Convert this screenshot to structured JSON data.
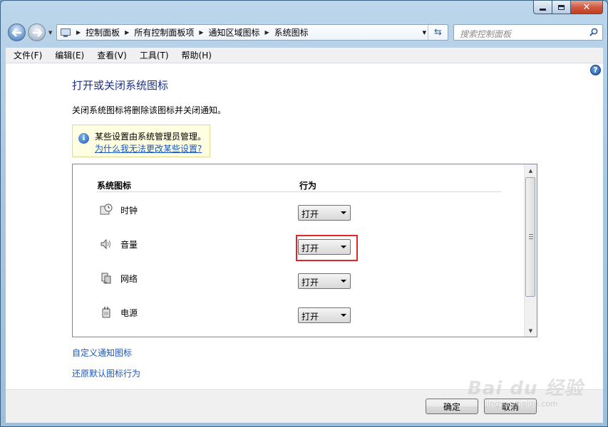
{
  "address": {
    "crumbs": [
      "控制面板",
      "所有控制面板项",
      "通知区域图标",
      "系统图标"
    ]
  },
  "search": {
    "placeholder": "搜索控制面板"
  },
  "menu": [
    "文件(F)",
    "编辑(E)",
    "查看(V)",
    "工具(T)",
    "帮助(H)"
  ],
  "page": {
    "title": "打开或关闭系统图标",
    "description": "关闭系统图标将删除该图标并关闭通知。",
    "info_text": "某些设置由系统管理员管理。",
    "info_link": "为什么我无法更改某些设置?"
  },
  "table": {
    "col_icon": "系统图标",
    "col_behavior": "行为",
    "rows": [
      {
        "name": "时钟",
        "value": "打开",
        "icon": "clock-icon"
      },
      {
        "name": "音量",
        "value": "打开",
        "icon": "speaker-icon"
      },
      {
        "name": "网络",
        "value": "打开",
        "icon": "network-icon"
      },
      {
        "name": "电源",
        "value": "打开",
        "icon": "power-icon"
      }
    ]
  },
  "links": {
    "customize": "自定义通知图标",
    "restore": "还原默认图标行为"
  },
  "buttons": {
    "ok": "确定",
    "cancel": "取消"
  },
  "watermark": {
    "main": "Bai du 经验",
    "sub": "jingyan.baidu.com"
  },
  "colors": {
    "title": "#1e3287",
    "link": "#1a56bd",
    "highlight": "#e0262b"
  }
}
